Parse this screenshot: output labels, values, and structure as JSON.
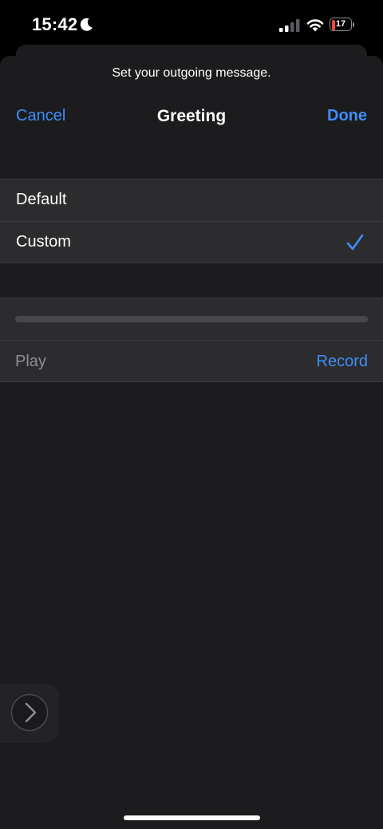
{
  "status_bar": {
    "time": "15:42",
    "battery_level": "17",
    "battery_fraction": 0.17,
    "icons": [
      "moon-icon",
      "signal-icon",
      "wifi-icon",
      "battery-icon"
    ]
  },
  "sheet": {
    "prompt": "Set your outgoing message.",
    "nav": {
      "cancel_label": "Cancel",
      "title": "Greeting",
      "done_label": "Done"
    }
  },
  "greeting_options": [
    {
      "label": "Default",
      "selected": false
    },
    {
      "label": "Custom",
      "selected": true
    }
  ],
  "recording": {
    "progress": 0,
    "play_label": "Play",
    "record_label": "Record"
  },
  "assistive_touch": {
    "icon": "chevron-right-icon"
  },
  "colors": {
    "accent": "#3e8ef7",
    "background": "#1c1c1e",
    "cell": "#2c2c2e",
    "disabled": "#8e8e93",
    "battery_low": "#ff453a"
  }
}
